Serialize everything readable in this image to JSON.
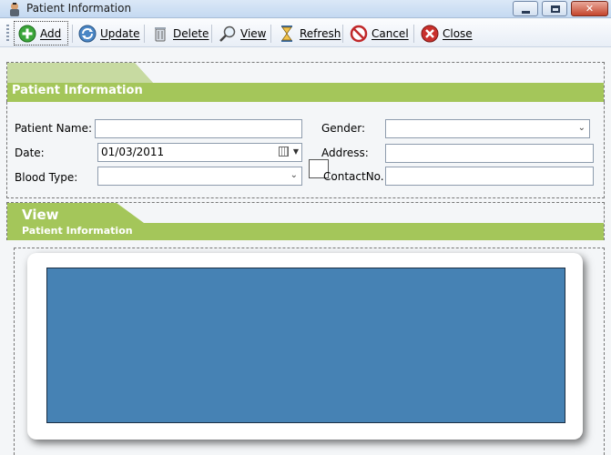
{
  "window": {
    "title": "Patient Information"
  },
  "toolbar": {
    "add": "Add",
    "update": "Update",
    "delete": "Delete",
    "view": "View",
    "refresh": "Refresh",
    "cancel": "Cancel",
    "close": "Close"
  },
  "section1": {
    "title": "Patient Information"
  },
  "form": {
    "patient_name_label": "Patient Name:",
    "patient_name_value": "",
    "gender_label": "Gender:",
    "gender_value": "",
    "date_label": "Date:",
    "date_value": "01/03/2011",
    "address_label": "Address:",
    "address_value": "",
    "blood_type_label": "Blood Type:",
    "blood_type_value": "",
    "contact_label": "ContactNo.",
    "contact_value": ""
  },
  "section2": {
    "title": "View",
    "subtitle": "Patient Information"
  },
  "colors": {
    "header_green": "#a4c65a",
    "grid_blue": "#4682b4"
  },
  "icons": [
    "add-icon",
    "update-icon",
    "delete-icon",
    "view-icon",
    "refresh-icon",
    "cancel-icon",
    "close-icon"
  ]
}
